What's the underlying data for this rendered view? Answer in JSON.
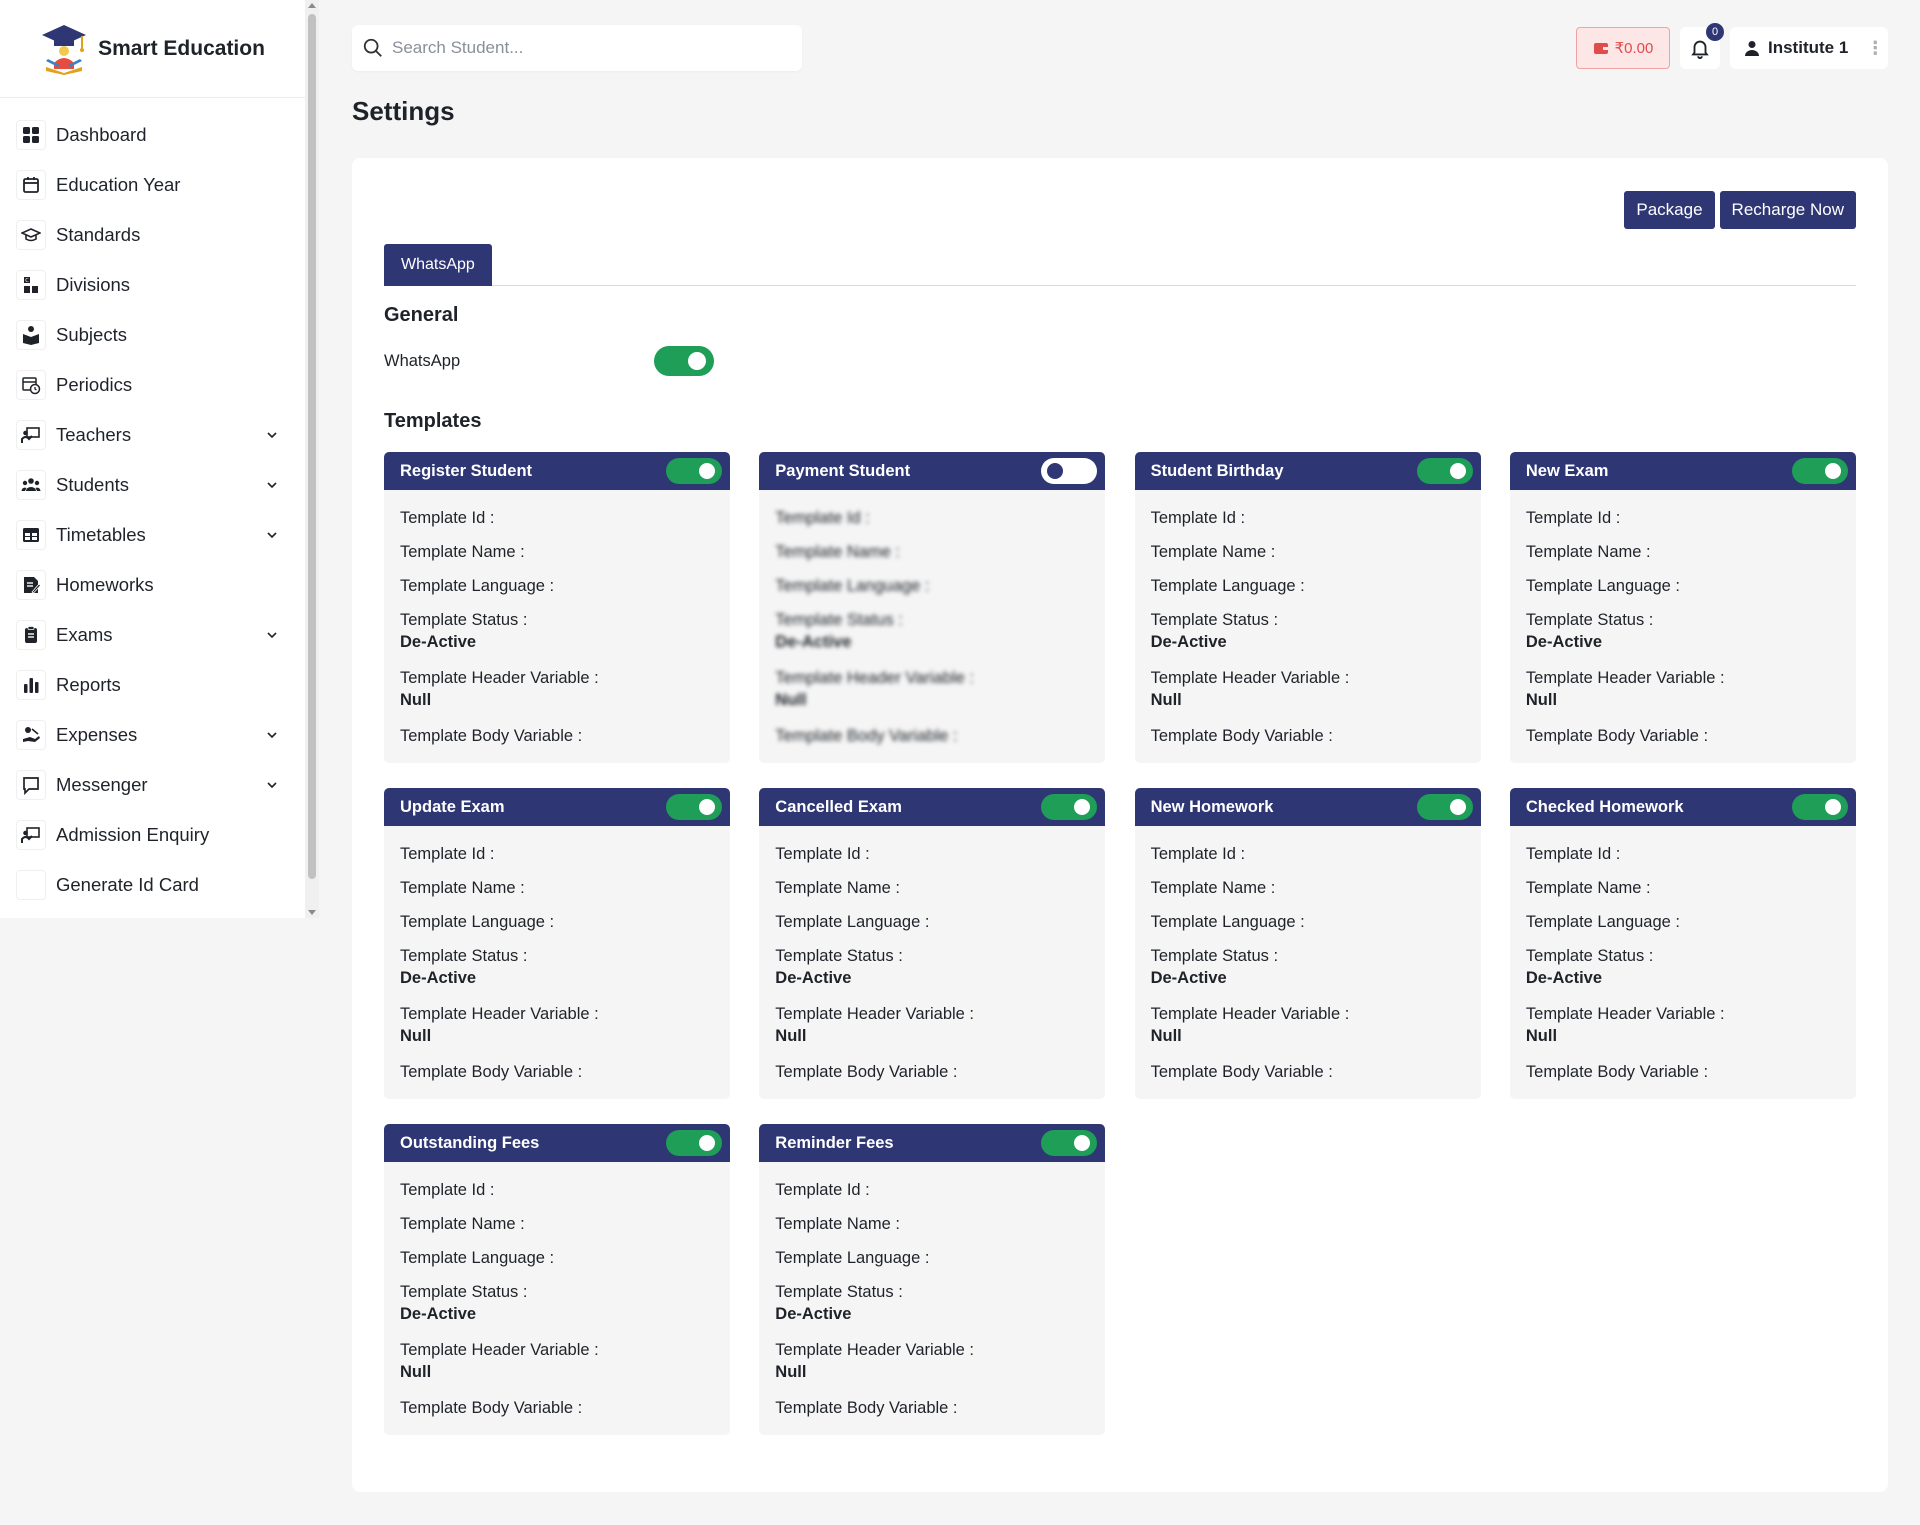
{
  "brand": {
    "name": "Smart Education"
  },
  "sidebar": {
    "items": [
      {
        "label": "Dashboard",
        "icon": "dashboard-icon",
        "expandable": false
      },
      {
        "label": "Education Year",
        "icon": "calendar-icon",
        "expandable": false
      },
      {
        "label": "Standards",
        "icon": "graduation-cap-icon",
        "expandable": false
      },
      {
        "label": "Divisions",
        "icon": "divisions-icon",
        "expandable": false
      },
      {
        "label": "Subjects",
        "icon": "book-reader-icon",
        "expandable": false
      },
      {
        "label": "Periodics",
        "icon": "calendar-clock-icon",
        "expandable": false
      },
      {
        "label": "Teachers",
        "icon": "teacher-board-icon",
        "expandable": true
      },
      {
        "label": "Students",
        "icon": "users-icon",
        "expandable": true
      },
      {
        "label": "Timetables",
        "icon": "table-icon",
        "expandable": true
      },
      {
        "label": "Homeworks",
        "icon": "homework-icon",
        "expandable": false
      },
      {
        "label": "Exams",
        "icon": "clipboard-icon",
        "expandable": true
      },
      {
        "label": "Reports",
        "icon": "bar-chart-icon",
        "expandable": false
      },
      {
        "label": "Expenses",
        "icon": "hand-coins-icon",
        "expandable": true
      },
      {
        "label": "Messenger",
        "icon": "message-icon",
        "expandable": true
      },
      {
        "label": "Admission Enquiry",
        "icon": "enquiry-board-icon",
        "expandable": false
      },
      {
        "label": "Generate Id Card",
        "icon": "id-card-icon",
        "expandable": false
      }
    ]
  },
  "header": {
    "search_placeholder": "Search Student...",
    "wallet_balance": "₹0.00",
    "notification_count": "0",
    "user_name": "Institute 1"
  },
  "page": {
    "title": "Settings"
  },
  "actions": {
    "package_label": "Package",
    "recharge_label": "Recharge Now"
  },
  "tabs": [
    {
      "label": "WhatsApp",
      "active": true
    }
  ],
  "general": {
    "title": "General",
    "whatsapp_label": "WhatsApp",
    "whatsapp_enabled": true
  },
  "templates": {
    "title": "Templates",
    "field_labels": {
      "id": "Template Id :",
      "name": "Template Name :",
      "language": "Template Language :",
      "status": "Template Status :",
      "header_variable": "Template Header Variable :",
      "body_variable": "Template Body Variable :"
    },
    "items": [
      {
        "title": "Register Student",
        "enabled": true,
        "status": "De-Active",
        "header_variable": "Null"
      },
      {
        "title": "Payment Student",
        "enabled": false,
        "status": "De-Active",
        "header_variable": "Null"
      },
      {
        "title": "Student Birthday",
        "enabled": true,
        "status": "De-Active",
        "header_variable": "Null"
      },
      {
        "title": "New Exam",
        "enabled": true,
        "status": "De-Active",
        "header_variable": "Null"
      },
      {
        "title": "Update Exam",
        "enabled": true,
        "status": "De-Active",
        "header_variable": "Null"
      },
      {
        "title": "Cancelled Exam",
        "enabled": true,
        "status": "De-Active",
        "header_variable": "Null"
      },
      {
        "title": "New Homework",
        "enabled": true,
        "status": "De-Active",
        "header_variable": "Null"
      },
      {
        "title": "Checked Homework",
        "enabled": true,
        "status": "De-Active",
        "header_variable": "Null"
      },
      {
        "title": "Outstanding Fees",
        "enabled": true,
        "status": "De-Active",
        "header_variable": "Null"
      },
      {
        "title": "Reminder Fees",
        "enabled": true,
        "status": "De-Active",
        "header_variable": "Null"
      }
    ]
  },
  "colors": {
    "primary": "#2e3774",
    "toggle_on": "#1e9e57",
    "wallet_bg": "#fde6e6",
    "wallet_text": "#e04b4b",
    "page_bg": "#f5f5f5"
  }
}
